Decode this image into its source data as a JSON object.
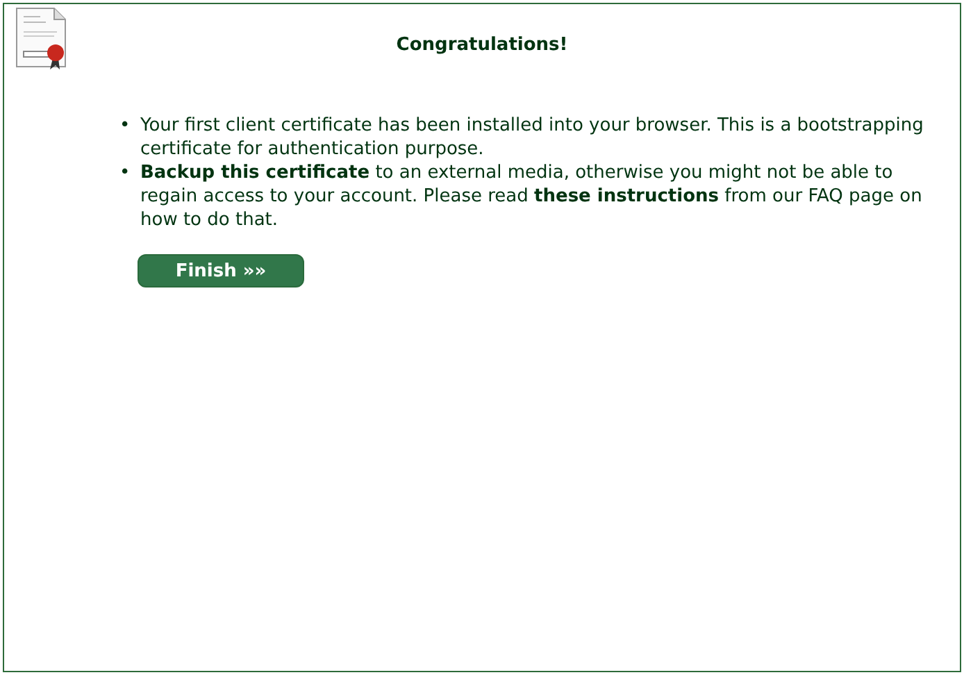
{
  "title": "Congratulations!",
  "items": [
    {
      "bullet": "•",
      "text": "Your first client certificate has been installed into your browser. This is a bootstrapping certificate for authentication purpose."
    },
    {
      "bullet": "•",
      "text": "**Backup this certificate** to an external media, otherwise you might not be able to regain access to your account. Please read **these instructions** from our FAQ page on how to do that."
    }
  ],
  "button": "Finish »»"
}
